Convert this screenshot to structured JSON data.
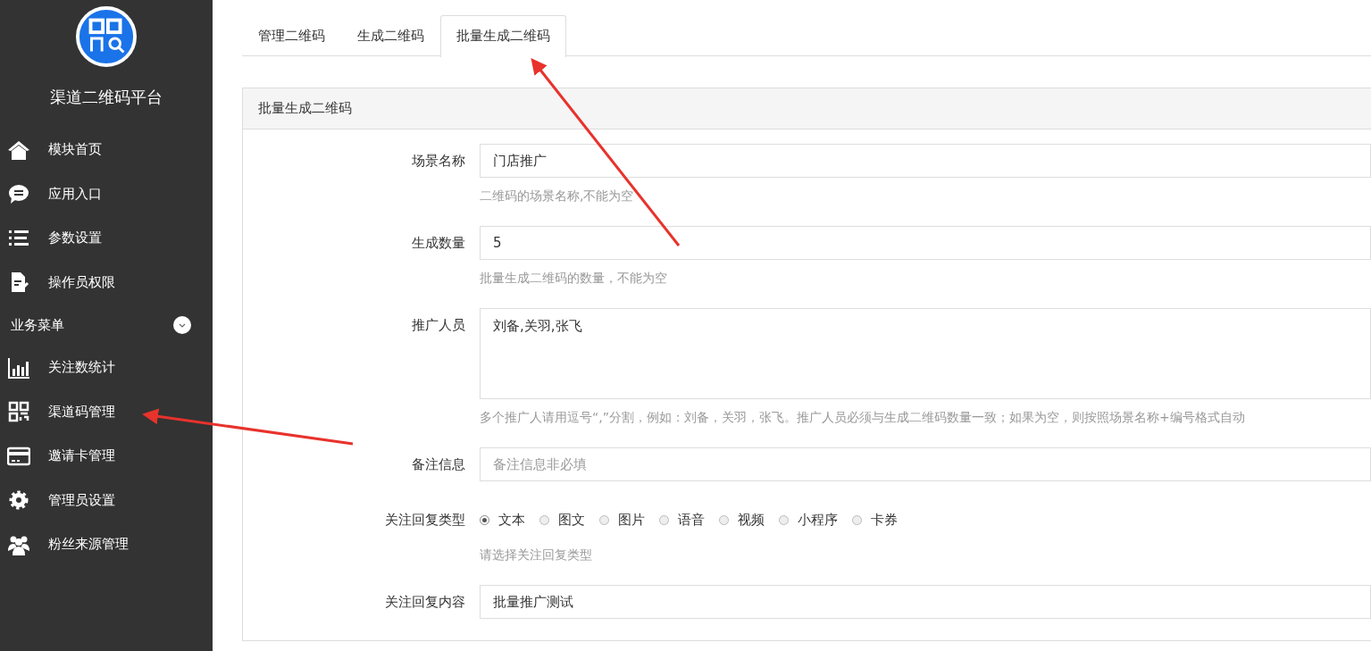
{
  "sidebar": {
    "title": "渠道二维码平台",
    "items": [
      {
        "label": "模块首页",
        "kind": "home"
      },
      {
        "label": "应用入口",
        "kind": "chat"
      },
      {
        "label": "参数设置",
        "kind": "list"
      },
      {
        "label": "操作员权限",
        "kind": "doc"
      }
    ],
    "section": {
      "label": "业务菜单",
      "expanded": true
    },
    "section_items": [
      {
        "label": "关注数统计",
        "kind": "chart"
      },
      {
        "label": "渠道码管理",
        "kind": "qr"
      },
      {
        "label": "邀请卡管理",
        "kind": "card"
      },
      {
        "label": "管理员设置",
        "kind": "gear"
      },
      {
        "label": "粉丝来源管理",
        "kind": "users"
      }
    ]
  },
  "tabs": [
    {
      "label": "管理二维码",
      "selected": false
    },
    {
      "label": "生成二维码",
      "selected": false
    },
    {
      "label": "批量生成二维码",
      "selected": true
    }
  ],
  "panel": {
    "title": "批量生成二维码",
    "fields": [
      {
        "kind": "input",
        "label": "场景名称",
        "value": "门店推广",
        "help": "二维码的场景名称,不能为空"
      },
      {
        "kind": "input",
        "label": "生成数量",
        "value": "5",
        "help": "批量生成二维码的数量，不能为空"
      },
      {
        "kind": "textarea",
        "label": "推广人员",
        "value": "刘备,关羽,张飞",
        "help": "多个推广人请用逗号“,”分割，例如：刘备，关羽，张飞。推广人员必须与生成二维码数量一致；如果为空，则按照场景名称+编号格式自动"
      },
      {
        "kind": "input",
        "label": "备注信息",
        "placeholder": "备注信息非必填"
      },
      {
        "kind": "radio",
        "label": "关注回复类型",
        "options": [
          {
            "label": "文本",
            "selected": true
          },
          {
            "label": "图文",
            "selected": false
          },
          {
            "label": "图片",
            "selected": false
          },
          {
            "label": "语音",
            "selected": false
          },
          {
            "label": "视频",
            "selected": false
          },
          {
            "label": "小程序",
            "selected": false
          },
          {
            "label": "卡券",
            "selected": false
          }
        ],
        "help": "请选择关注回复类型"
      },
      {
        "kind": "input",
        "label": "关注回复内容",
        "value": "批量推广测试"
      }
    ]
  }
}
